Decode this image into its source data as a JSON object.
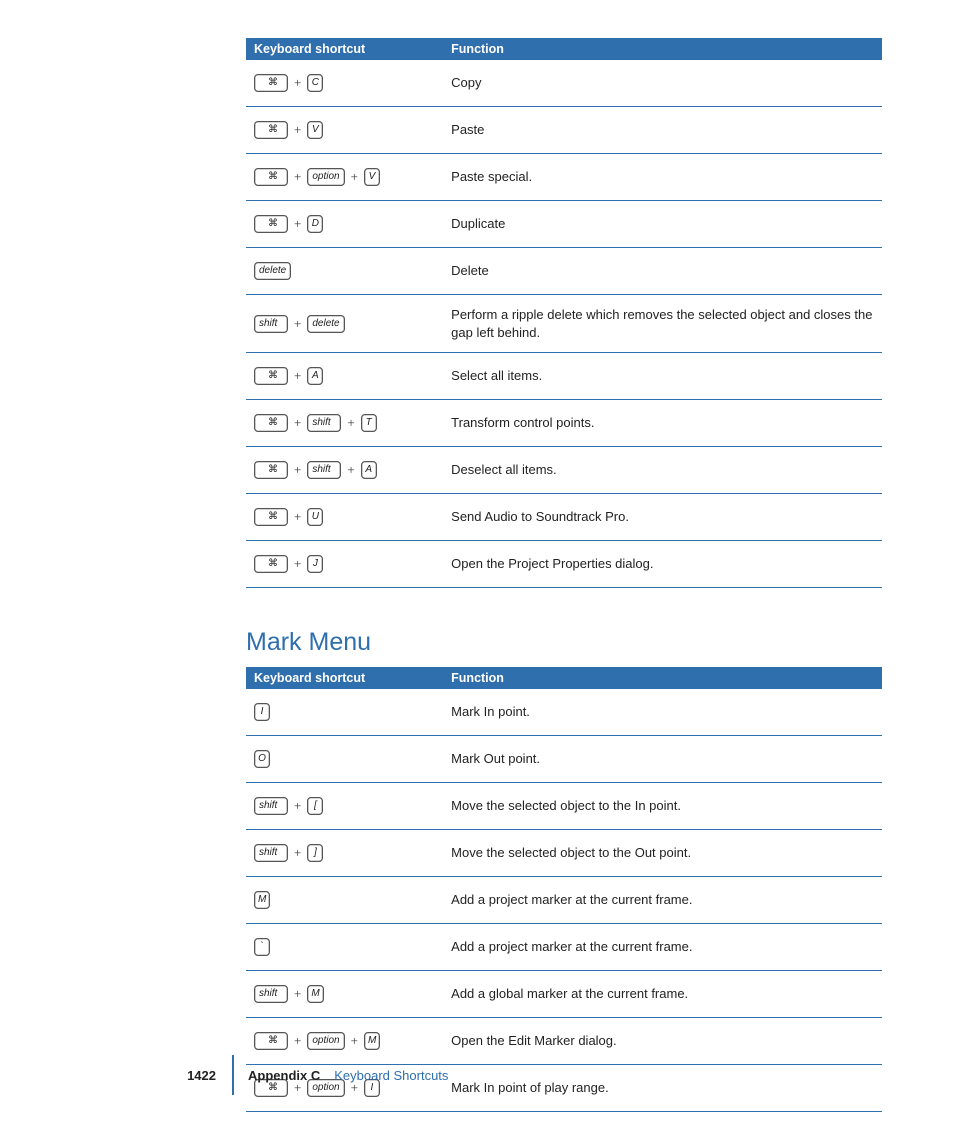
{
  "columns": {
    "shortcut": "Keyboard shortcut",
    "function": "Function"
  },
  "table1": [
    {
      "keys": [
        [
          "cmd"
        ],
        [
          "C"
        ]
      ],
      "func": "Copy"
    },
    {
      "keys": [
        [
          "cmd"
        ],
        [
          "V"
        ]
      ],
      "func": "Paste"
    },
    {
      "keys": [
        [
          "cmd"
        ],
        [
          "option",
          "wide"
        ],
        [
          "V"
        ]
      ],
      "func": "Paste special."
    },
    {
      "keys": [
        [
          "cmd"
        ],
        [
          "D"
        ]
      ],
      "func": "Duplicate"
    },
    {
      "keys": [
        [
          "delete",
          "wide"
        ]
      ],
      "func": "Delete"
    },
    {
      "keys": [
        [
          "shift",
          "wide"
        ],
        [
          "delete",
          "wide"
        ]
      ],
      "func": "Perform a ripple delete which removes the selected object and closes the gap left behind."
    },
    {
      "keys": [
        [
          "cmd"
        ],
        [
          "A"
        ]
      ],
      "func": "Select all items."
    },
    {
      "keys": [
        [
          "cmd"
        ],
        [
          "shift",
          "wide"
        ],
        [
          "T"
        ]
      ],
      "func": "Transform control points."
    },
    {
      "keys": [
        [
          "cmd"
        ],
        [
          "shift",
          "wide"
        ],
        [
          "A"
        ]
      ],
      "func": "Deselect all items."
    },
    {
      "keys": [
        [
          "cmd"
        ],
        [
          "U"
        ]
      ],
      "func": "Send Audio to Soundtrack Pro."
    },
    {
      "keys": [
        [
          "cmd"
        ],
        [
          "J"
        ]
      ],
      "func": "Open the Project Properties dialog."
    }
  ],
  "section2_title": "Mark Menu",
  "table2": [
    {
      "keys": [
        [
          "I"
        ]
      ],
      "func": "Mark In point."
    },
    {
      "keys": [
        [
          "O"
        ]
      ],
      "func": "Mark Out point."
    },
    {
      "keys": [
        [
          "shift",
          "wide"
        ],
        [
          "["
        ]
      ],
      "func": "Move the selected object to the In point."
    },
    {
      "keys": [
        [
          "shift",
          "wide"
        ],
        [
          "]"
        ]
      ],
      "func": "Move the selected object to the Out point."
    },
    {
      "keys": [
        [
          "M"
        ]
      ],
      "func": "Add a project marker at the current frame."
    },
    {
      "keys": [
        [
          "`"
        ]
      ],
      "func": "Add a project marker at the current frame."
    },
    {
      "keys": [
        [
          "shift",
          "wide"
        ],
        [
          "M"
        ]
      ],
      "func": "Add a global marker at the current frame."
    },
    {
      "keys": [
        [
          "cmd"
        ],
        [
          "option",
          "wide"
        ],
        [
          "M"
        ]
      ],
      "func": "Open the Edit Marker dialog."
    },
    {
      "keys": [
        [
          "cmd"
        ],
        [
          "option",
          "wide"
        ],
        [
          "I"
        ]
      ],
      "func": "Mark In point of play range."
    }
  ],
  "footer": {
    "page": "1422",
    "appendix": "Appendix C",
    "title": "Keyboard Shortcuts"
  }
}
